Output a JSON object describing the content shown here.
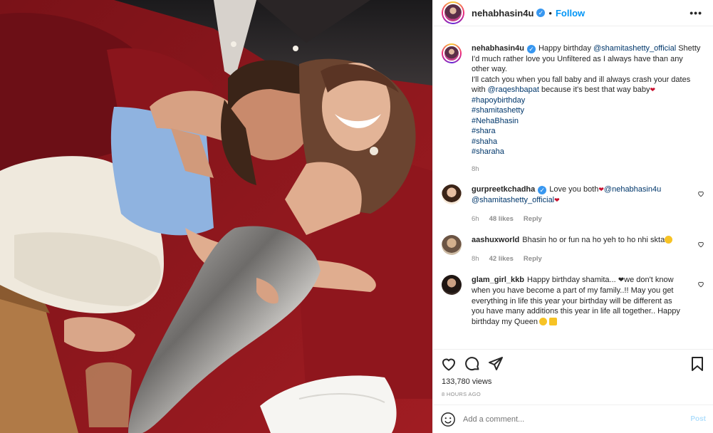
{
  "header": {
    "username": "nehabhasin4u",
    "separator": "•",
    "follow_label": "Follow",
    "more_label": "•••"
  },
  "caption": {
    "username": "nehabhasin4u",
    "text_before_mention": "Happy birthday ",
    "mention1": "@shamitashetty_official",
    "text_after_mention1": " Shetty I'd much rather love you Unfiltered as I always have than any other way.",
    "line2_before": "I'll catch you when you fall baby and ill always crash your dates with ",
    "mention2": "@raqeshbapat",
    "line2_after": " because it's best that way baby",
    "hashtags": [
      "#hapoybirthday",
      "#shamitashetty",
      "#NehaBhasin",
      "#shara",
      "#shaha",
      "#sharaha"
    ],
    "time": "8h"
  },
  "comments": [
    {
      "username": "gurpreetkchadha",
      "text": "Love you both",
      "mention1": "@nehabhasin4u",
      "mention2": "@shamitashetty_official",
      "time": "6h",
      "likes": "48 likes",
      "reply": "Reply"
    },
    {
      "username": "aashuxworld",
      "text": "Bhasin ho or fun na ho yeh to ho nhi skta",
      "time": "8h",
      "likes": "42 likes",
      "reply": "Reply"
    },
    {
      "username": "glam_girl_kkb",
      "text_part1": "Happy birthday shamita... ",
      "text_part2": "we don't know when you have become a part of my family..!! May you get everything in life this year your birthday will be different as you have many additions this year in life all together.. Happy birthday my Queen"
    }
  ],
  "stats": {
    "views": "133,780 views",
    "ago": "8 HOURS AGO"
  },
  "composer": {
    "placeholder": "Add a comment...",
    "post_label": "Post"
  },
  "icons": [
    "verified-badge-icon",
    "more-options-icon",
    "heart-icon",
    "comment-icon",
    "share-icon",
    "bookmark-icon",
    "emoji-icon"
  ],
  "colors": {
    "link": "#0095f6",
    "mention": "#00376b",
    "muted": "#8e8e8e",
    "post_disabled": "#b2dffc"
  }
}
